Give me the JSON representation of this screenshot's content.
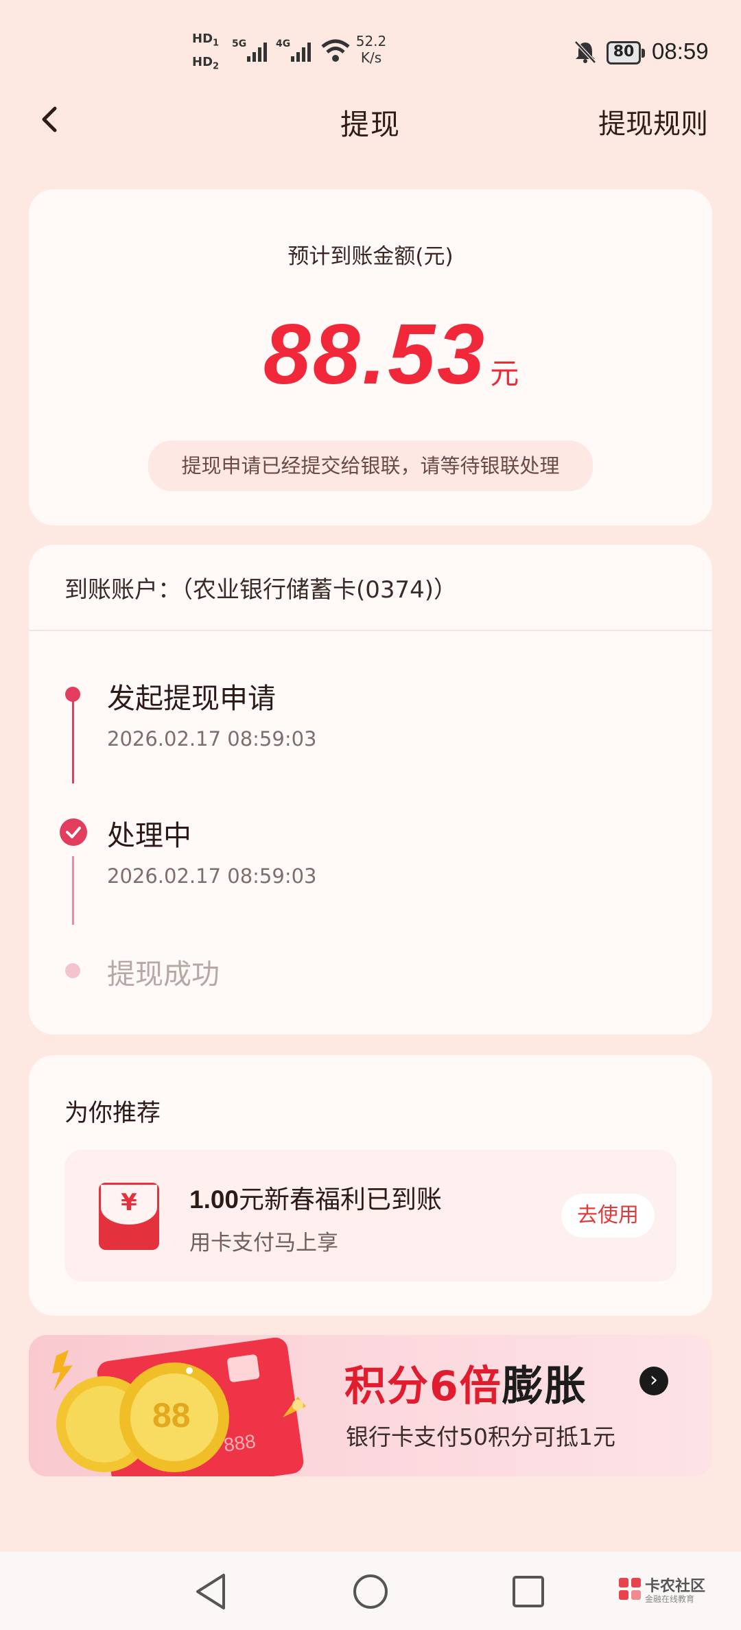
{
  "status_bar": {
    "hd1": "HD",
    "hd1_sub": "1",
    "hd2": "HD",
    "hd2_sub": "2",
    "signal1": "5G",
    "signal2": "4G",
    "speed_value": "52.2",
    "speed_unit": "K/s",
    "battery": "80",
    "time": "08:59"
  },
  "header": {
    "back_icon": "chevron-left-icon",
    "title": "提现",
    "rules_link": "提现规则"
  },
  "amount_card": {
    "label": "预计到账金额(元)",
    "amount": "88.53",
    "unit": "元",
    "notice": "提现申请已经提交给银联，请等待银联处理"
  },
  "progress_card": {
    "account": "到账账户：（农业银行储蓄卡(0374)）",
    "steps": [
      {
        "title": "发起提现申请",
        "time": "2026.02.17 08:59:03",
        "state": "done"
      },
      {
        "title": "处理中",
        "time": "2026.02.17 08:59:03",
        "state": "current"
      },
      {
        "title": "提现成功",
        "time": "",
        "state": "pending"
      }
    ],
    "colors": {
      "active": "#e23d5c",
      "pending": "#f4c4cd"
    }
  },
  "recommend": {
    "title": "为你推荐",
    "item": {
      "icon": "red-envelope-icon",
      "icon_glyph": "¥",
      "amount": "1.00",
      "main_rest": "元新春福利已到账",
      "sub": "用卡支付马上享",
      "button": "去使用"
    }
  },
  "banner": {
    "title_red": "积分6倍",
    "title_dark": "膨胀",
    "arrow": "›",
    "subtitle": "银行卡支付50积分可抵1元",
    "card_text": "888",
    "coin_text": "88"
  },
  "nav": {
    "back": "triangle-back-icon",
    "home": "circle-home-icon",
    "recents": "square-recents-icon"
  },
  "watermark": {
    "name": "卡农社区",
    "tagline": "金融在线教育"
  },
  "colors": {
    "background": "#fde9e2",
    "accent": "#f0283a"
  }
}
